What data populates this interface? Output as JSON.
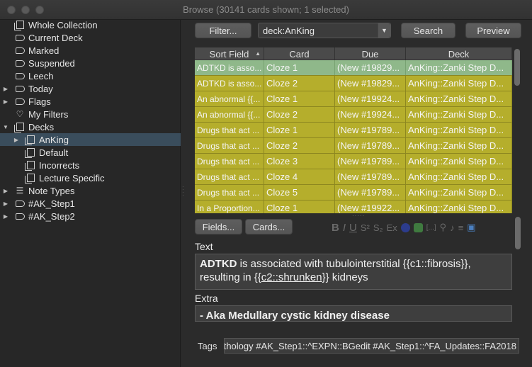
{
  "window": {
    "title": "Browse (30141 cards shown; 1 selected)"
  },
  "sidebar": {
    "items": [
      {
        "label": "Whole Collection",
        "icon": "collection-icon"
      },
      {
        "label": "Current Deck",
        "icon": "tag-icon"
      },
      {
        "label": "Marked",
        "icon": "tag-icon"
      },
      {
        "label": "Suspended",
        "icon": "tag-icon"
      },
      {
        "label": "Leech",
        "icon": "tag-icon"
      },
      {
        "label": "Today",
        "icon": "tag-icon"
      },
      {
        "label": "Flags",
        "icon": "tag-icon"
      },
      {
        "label": "My Filters",
        "icon": "heart-icon"
      },
      {
        "label": "Decks",
        "icon": "deck-icon"
      },
      {
        "label": "AnKing",
        "icon": "deck-icon"
      },
      {
        "label": "Default",
        "icon": "deck-icon"
      },
      {
        "label": "Incorrects",
        "icon": "deck-icon"
      },
      {
        "label": "Lecture Specific",
        "icon": "deck-icon"
      },
      {
        "label": "Note Types",
        "icon": "note-types-icon"
      },
      {
        "label": "#AK_Step1",
        "icon": "tag-icon"
      },
      {
        "label": "#AK_Step2",
        "icon": "tag-icon"
      }
    ]
  },
  "toolbar": {
    "filter_label": "Filter...",
    "search_value": "deck:AnKing",
    "search_button": "Search",
    "preview_button": "Preview"
  },
  "table": {
    "columns": [
      "Sort Field",
      "Card",
      "Due",
      "Deck"
    ],
    "rows": [
      {
        "sort_field": "ADTKD is asso...",
        "card": "Cloze 1",
        "due": "(New #19829...",
        "deck": "AnKing::Zanki Step D..."
      },
      {
        "sort_field": "ADTKD is asso...",
        "card": "Cloze 2",
        "due": "(New #19829...",
        "deck": "AnKing::Zanki Step D..."
      },
      {
        "sort_field": "An abnormal {{...",
        "card": "Cloze 1",
        "due": "(New #19924...",
        "deck": "AnKing::Zanki Step D..."
      },
      {
        "sort_field": "An abnormal {{...",
        "card": "Cloze 2",
        "due": "(New #19924...",
        "deck": "AnKing::Zanki Step D..."
      },
      {
        "sort_field": "Drugs that act ...",
        "card": "Cloze 1",
        "due": "(New #19789...",
        "deck": "AnKing::Zanki Step D..."
      },
      {
        "sort_field": "Drugs that act ...",
        "card": "Cloze 2",
        "due": "(New #19789...",
        "deck": "AnKing::Zanki Step D..."
      },
      {
        "sort_field": "Drugs that act ...",
        "card": "Cloze 3",
        "due": "(New #19789...",
        "deck": "AnKing::Zanki Step D..."
      },
      {
        "sort_field": "Drugs that act ...",
        "card": "Cloze 4",
        "due": "(New #19789...",
        "deck": "AnKing::Zanki Step D..."
      },
      {
        "sort_field": "Drugs that act ...",
        "card": "Cloze 5",
        "due": "(New #19789...",
        "deck": "AnKing::Zanki Step D..."
      },
      {
        "sort_field": "In a Proportion...",
        "card": "Cloze 1",
        "due": "(New #19922...",
        "deck": "AnKing::Zanki Step D..."
      }
    ]
  },
  "editor": {
    "fields_button": "Fields...",
    "cards_button": "Cards...",
    "text_label": "Text",
    "text_bold": "ADTKD",
    "text_part1": " is associated with tubulointerstitial {{c1::fibrosis}}, resulting in {{",
    "text_underlined": "c2::shrunken",
    "text_part2": "}} kidneys",
    "extra_label": "Extra",
    "extra_prefix": "- Aka ",
    "extra_bold": "Medullary cystic kidney disease",
    "format_buttons": [
      "B",
      "I",
      "U",
      "S²",
      "S₂",
      "Ex",
      "[...]"
    ],
    "tags_label": "Tags",
    "tags_value": "thology #AK_Step1::^EXPN::BGedit #AK_Step1::^FA_Updates::FA2018"
  },
  "colors": {
    "row_normal": "#b5ae2c",
    "row_selected": "#8fb88a",
    "sidebar_selected": "#3a4d5c"
  }
}
